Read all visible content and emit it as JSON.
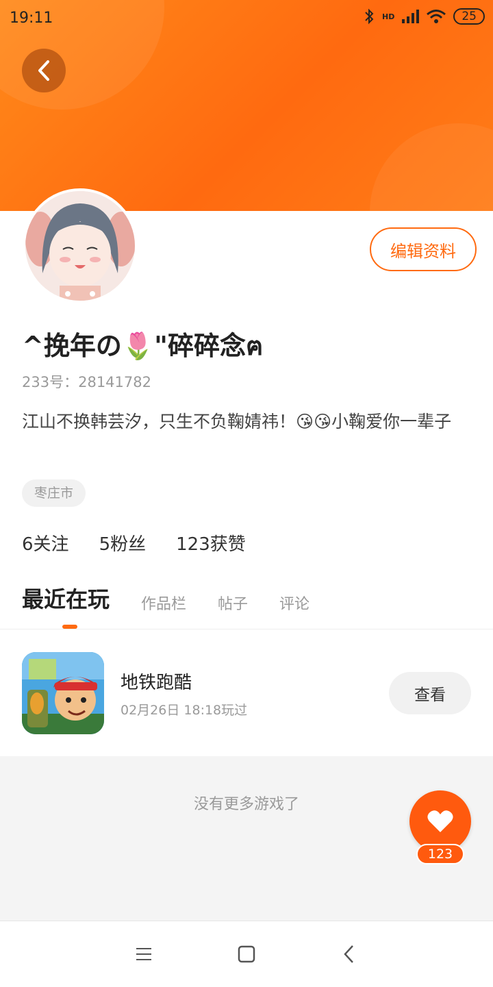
{
  "status_bar": {
    "time": "19:11",
    "battery": "25",
    "network_label": "HD"
  },
  "profile": {
    "edit_label": "编辑资料",
    "nickname": "^挽年の🌷\"碎碎念ฅ",
    "uid_label": "233号：",
    "uid_value": "28141782",
    "bio": "江山不换韩芸汐，只生不负鞠婧祎！😘😘小鞠爱你一辈子",
    "location": "枣庄市"
  },
  "stats": [
    {
      "value": "6",
      "label": "关注"
    },
    {
      "value": "5",
      "label": "粉丝"
    },
    {
      "value": "123",
      "label": "获赞"
    }
  ],
  "tabs": [
    {
      "label": "最近在玩",
      "active": true
    },
    {
      "label": "作品栏",
      "active": false
    },
    {
      "label": "帖子",
      "active": false
    },
    {
      "label": "评论",
      "active": false
    }
  ],
  "games": [
    {
      "title": "地铁跑酷",
      "played_time": "02月26日 18:18玩过",
      "action_label": "查看"
    }
  ],
  "empty_message": "没有更多游戏了",
  "like_count": "123",
  "colors": {
    "accent": "#ff6a10",
    "header_start": "#ff8a1a",
    "header_end": "#ff6a10"
  },
  "icons": {
    "back": "back-arrow-icon",
    "like": "heart-icon",
    "nav": [
      "menu-icon",
      "home-icon",
      "back-icon"
    ]
  }
}
